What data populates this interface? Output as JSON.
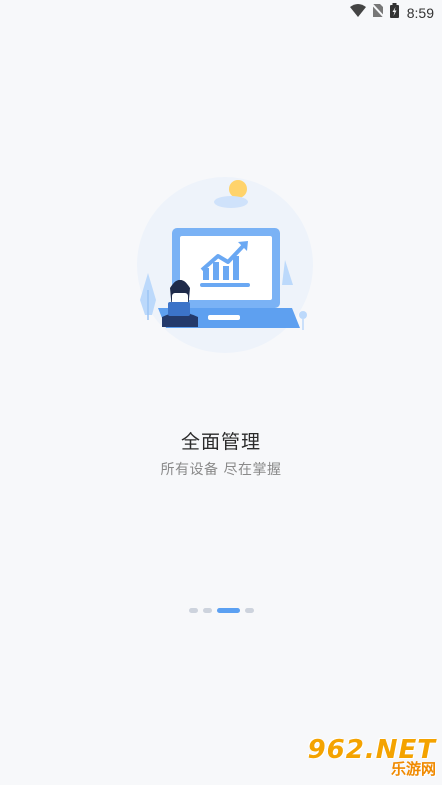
{
  "status_bar": {
    "time": "8:59",
    "icons": [
      "wifi-icon",
      "no-sim-icon",
      "battery-charging-icon"
    ]
  },
  "onboarding": {
    "title": "全面管理",
    "subtitle": "所有设备 尽在掌握",
    "page_indicator": {
      "pages": 4,
      "active_index": 2
    }
  },
  "watermark": {
    "brand": "962.NET",
    "sub": "乐游网"
  },
  "colors": {
    "accent": "#5ba0f2",
    "background": "#f7f8fa"
  }
}
